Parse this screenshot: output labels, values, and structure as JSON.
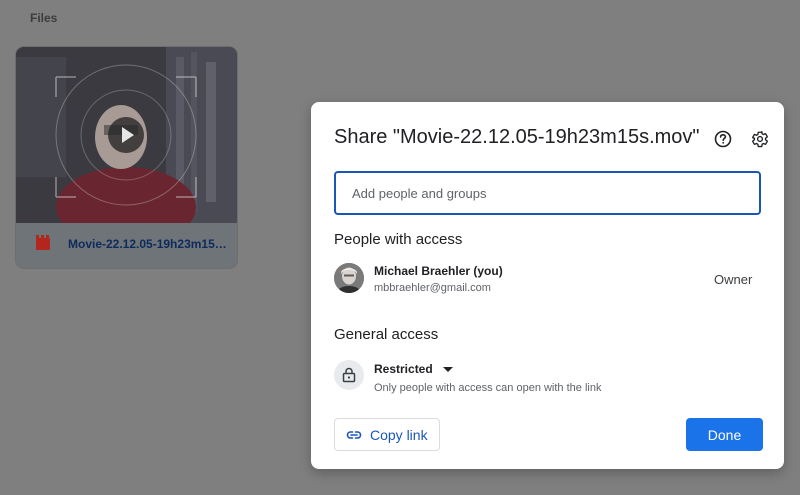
{
  "background": {
    "files_label": "Files",
    "file_card": {
      "name": "Movie-22.12.05-19h23m15…",
      "icon": "video-file-icon",
      "thumbnail_overlay_icon": "play-icon"
    }
  },
  "dialog": {
    "title": "Share \"Movie-22.12.05-19h23m15s.mov\"",
    "help_icon": "help-icon",
    "settings_icon": "gear-icon",
    "add_people_placeholder": "Add people and groups",
    "people_heading": "People with access",
    "people": [
      {
        "name": "Michael Braehler (you)",
        "email": "mbbraehler@gmail.com",
        "role": "Owner"
      }
    ],
    "general_heading": "General access",
    "general_access": {
      "icon": "lock-icon",
      "value": "Restricted",
      "description": "Only people with access can open with the link"
    },
    "copy_link_label": "Copy link",
    "copy_link_icon": "link-icon",
    "done_label": "Done"
  },
  "colors": {
    "accent": "#1a73e8",
    "input_border": "#1a56b8",
    "file_icon": "#b3261e"
  }
}
